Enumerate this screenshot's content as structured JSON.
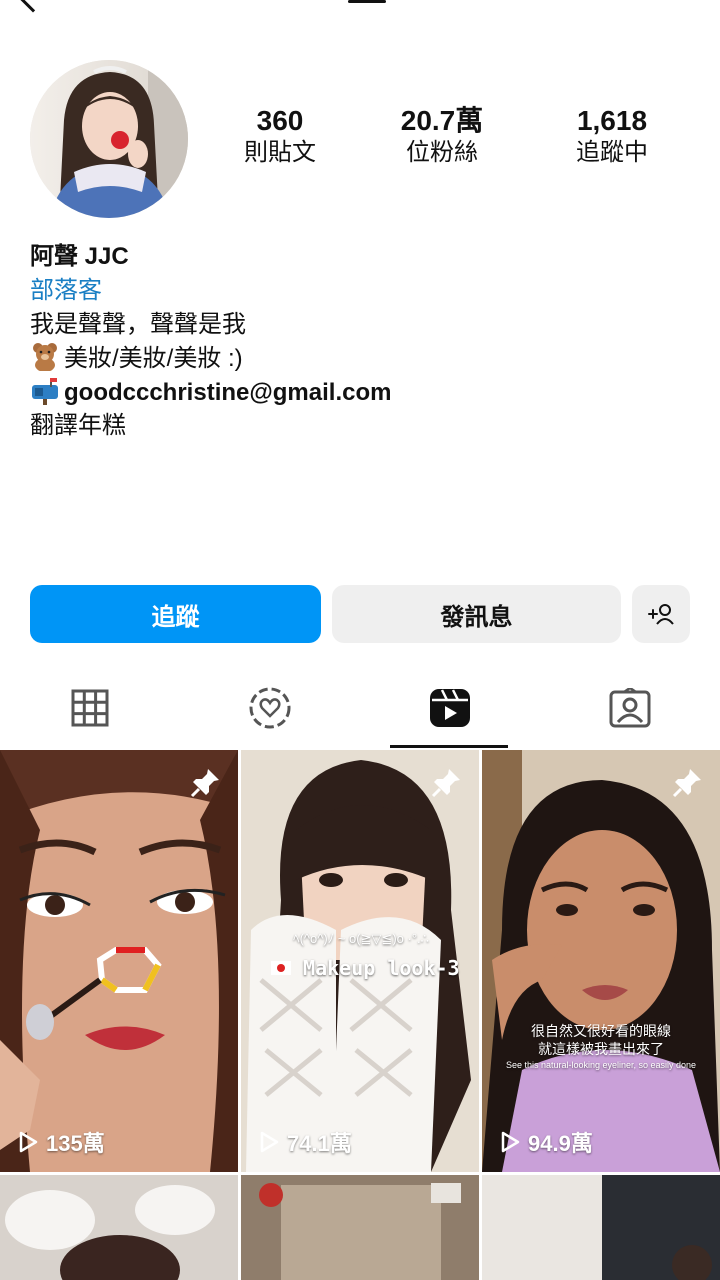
{
  "profile": {
    "stats": [
      {
        "value": "360",
        "label": "則貼文"
      },
      {
        "value": "20.7萬",
        "label": "位粉絲"
      },
      {
        "value": "1,618",
        "label": "追蹤中"
      }
    ],
    "name": "阿聲 JJC",
    "category": "部落客",
    "bio_line1": "我是聲聲，聲聲是我",
    "bio_line2": "美妝/美妝/美妝 :)",
    "email": "goodccchristine@gmail.com",
    "bio_line4": "翻譯年糕"
  },
  "actions": {
    "follow_label": "追蹤",
    "message_label": "發訊息"
  },
  "tabs": [
    {
      "icon": "grid-icon",
      "active": false
    },
    {
      "icon": "heart-circle-icon",
      "active": false
    },
    {
      "icon": "reels-icon",
      "active": true
    },
    {
      "icon": "tagged-icon",
      "active": false
    }
  ],
  "reels": [
    {
      "views": "135萬",
      "pinned": true
    },
    {
      "views": "74.1萬",
      "pinned": true,
      "caption": "Makeup look-3",
      "caption_top": "ﾍ(^o^)ﾉ ~ o(≧▽≦)o ·°.∴"
    },
    {
      "views": "94.9萬",
      "pinned": true,
      "caption_zh_1": "很自然又很好看的眼線",
      "caption_zh_2": "就這樣被我畫出來了",
      "caption_en": "See this natural-looking eyeliner, so easily done"
    }
  ],
  "colors": {
    "accent": "#0095f6",
    "link": "#1a7fc4",
    "button_bg": "#efefef"
  }
}
